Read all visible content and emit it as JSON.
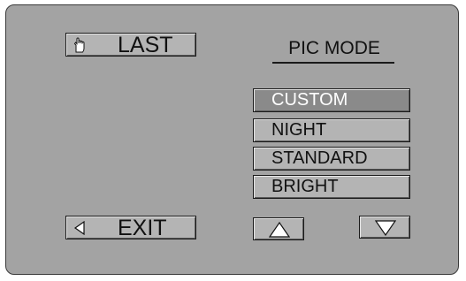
{
  "menu": {
    "last_label": "LAST",
    "exit_label": "EXIT",
    "title": "PIC MODE",
    "modes": [
      {
        "label": "CUSTOM",
        "selected": true
      },
      {
        "label": "NIGHT",
        "selected": false
      },
      {
        "label": "STANDARD",
        "selected": false
      },
      {
        "label": "BRIGHT",
        "selected": false
      }
    ]
  },
  "icons": {
    "last": "hand-pointer-icon",
    "exit": "left-arrow-icon",
    "up": "up-arrow-icon",
    "down": "down-arrow-icon"
  },
  "colors": {
    "panel": "#a3a3a3",
    "button": "#b4b4b4",
    "selected_item": "#8a8a8a",
    "text": "#111111",
    "selected_text": "#ffffff"
  }
}
